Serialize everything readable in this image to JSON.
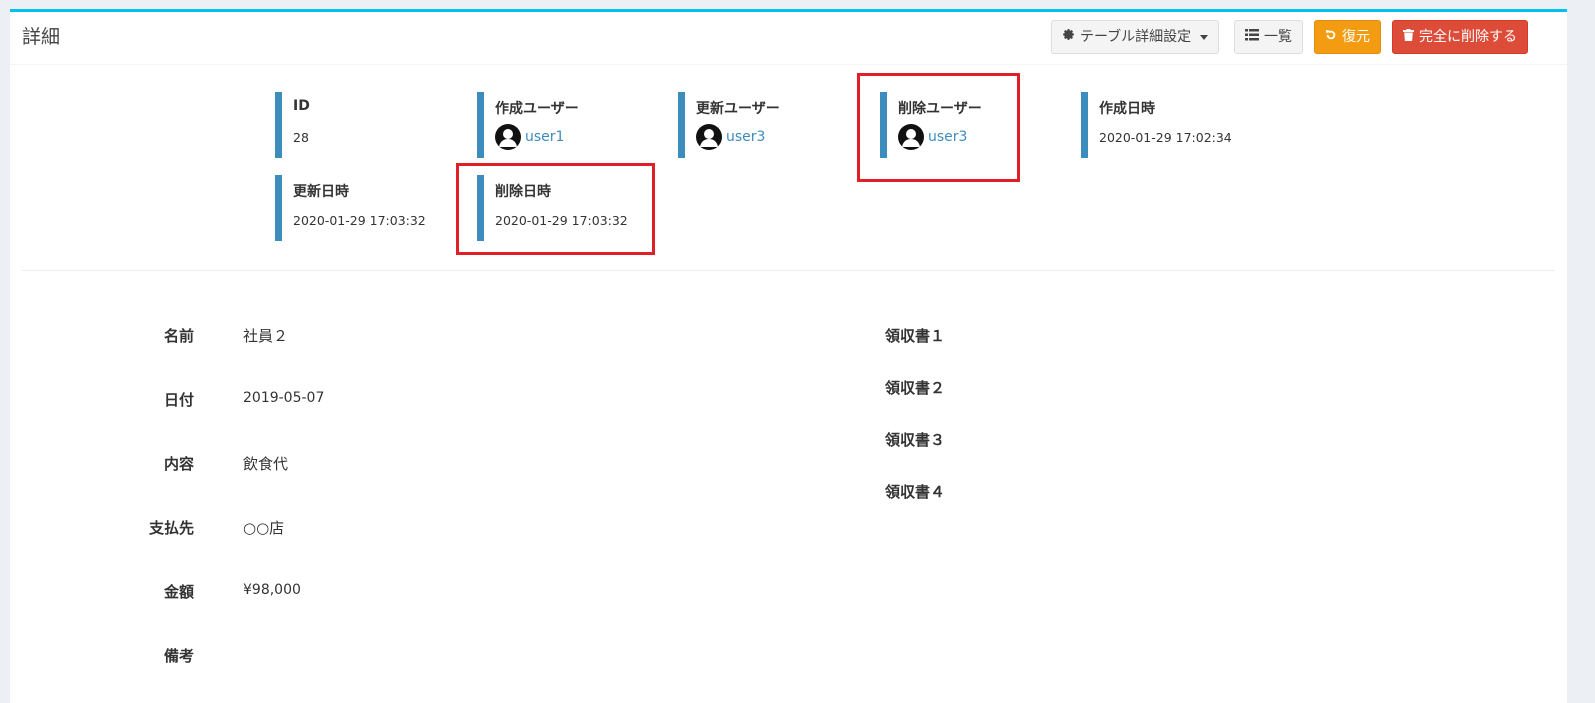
{
  "header": {
    "title": "詳細",
    "table_settings_label": "テーブル詳細設定",
    "list_label": "一覧",
    "restore_label": "復元",
    "delete_label": "完全に削除する"
  },
  "meta": {
    "id": {
      "label": "ID",
      "value": "28"
    },
    "created_user": {
      "label": "作成ユーザー",
      "value": "user1"
    },
    "updated_user": {
      "label": "更新ユーザー",
      "value": "user3"
    },
    "deleted_user": {
      "label": "削除ユーザー",
      "value": "user3"
    },
    "created_at": {
      "label": "作成日時",
      "value": "2020-01-29 17:02:34"
    },
    "updated_at": {
      "label": "更新日時",
      "value": "2020-01-29 17:03:32"
    },
    "deleted_at": {
      "label": "削除日時",
      "value": "2020-01-29 17:03:32"
    }
  },
  "fields": {
    "name": {
      "label": "名前",
      "value": "社員２"
    },
    "date": {
      "label": "日付",
      "value": "2019-05-07"
    },
    "content": {
      "label": "内容",
      "value": "飲食代"
    },
    "payee": {
      "label": "支払先",
      "value": "○○店"
    },
    "amount": {
      "label": "金額",
      "value": "¥98,000"
    },
    "note": {
      "label": "備考",
      "value": ""
    }
  },
  "receipts": [
    "領収書１",
    "領収書２",
    "領収書３",
    "領収書４"
  ],
  "colors": {
    "accent_top": "#00c0ef",
    "meta_bar": "#3c8dbc",
    "highlight": "#e01f26",
    "restore_button": "#f39c12",
    "delete_button": "#dd4b39"
  },
  "icons": {
    "table_settings": "gear-icon",
    "list": "list-icon",
    "restore": "undo-icon",
    "delete": "trash-icon",
    "user": "user-avatar-icon"
  }
}
